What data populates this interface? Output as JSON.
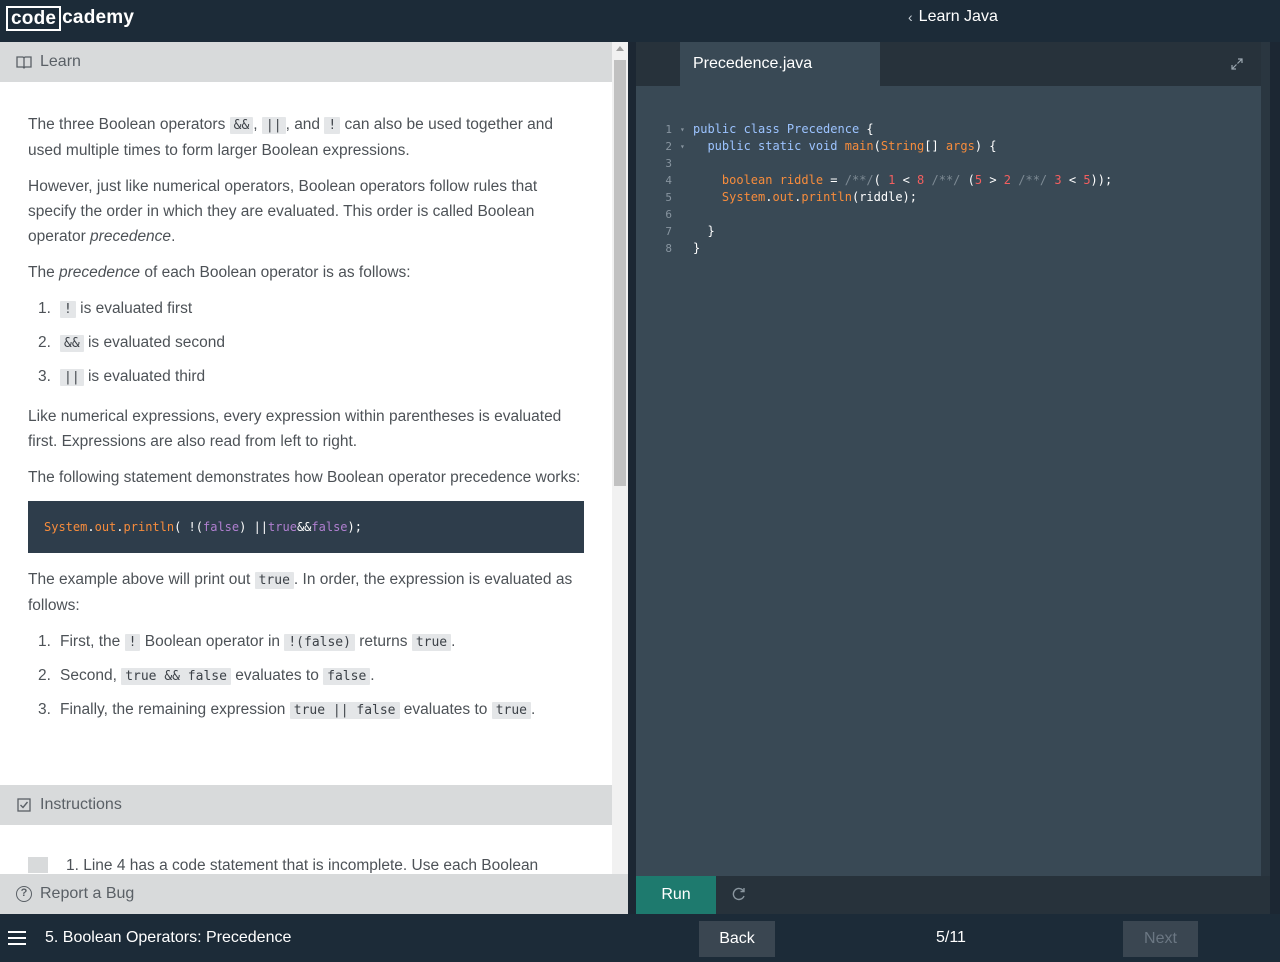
{
  "header": {
    "logo_code": "code",
    "logo_academy": "cademy",
    "course_link": "Learn Java"
  },
  "learn": {
    "heading": "Learn",
    "p1": {
      "a": "The three Boolean operators ",
      "op1": "&&",
      "b": ", ",
      "op2": "||",
      "c": ", and ",
      "op3": "!",
      "d": " can also be used together and used multiple times to form larger Boolean expressions."
    },
    "p2": {
      "a": "However, just like numerical operators, Boolean operators follow rules that specify the order in which they are evaluated. This order is called Boolean operator ",
      "em": "precedence",
      "b": "."
    },
    "p3": {
      "a": "The ",
      "em": "precedence",
      "b": " of each Boolean operator is as follows:"
    },
    "list1": [
      {
        "num": "1.",
        "code": "!",
        "text": " is evaluated first"
      },
      {
        "num": "2.",
        "code": "&&",
        "text": " is evaluated second"
      },
      {
        "num": "3.",
        "code": "||",
        "text": " is evaluated third"
      }
    ],
    "p4": "Like numerical expressions, every expression within parentheses is evaluated first. Expressions are also read from left to right.",
    "p5": "The following statement demonstrates how Boolean operator precedence works:",
    "codeblock": {
      "t1": "System",
      "t2": ".",
      "t3": "out",
      "t4": ".",
      "t5": "println",
      "t6": "( !(",
      "t7": "false",
      "t8": ") || ",
      "t9": "true",
      "t10": " && ",
      "t11": "false",
      "t12": ");"
    },
    "p6": {
      "a": "The example above will print out ",
      "code": "true",
      "b": ". In order, the expression is evaluated as follows:"
    },
    "list2": [
      {
        "num": "1.",
        "a": "First, the ",
        "c1": "!",
        "b": " Boolean operator in ",
        "c2": "!(false)",
        "c": " returns ",
        "c3": "true",
        "d": "."
      },
      {
        "num": "2.",
        "a": "Second, ",
        "c1": "true && false",
        "b": " evaluates to ",
        "c2": "false",
        "c": "."
      },
      {
        "num": "3.",
        "a": "Finally, the remaining expression ",
        "c1": "true || false",
        "b": " evaluates to ",
        "c2": "true",
        "c": "."
      }
    ]
  },
  "instructions": {
    "heading": "Instructions",
    "item_text": "1. Line 4 has a code statement that is incomplete. Use each Boolean"
  },
  "report_bug": "Report a Bug",
  "editor": {
    "file_tab": "Precedence.java",
    "lines": [
      {
        "n": "1",
        "fold": "▾"
      },
      {
        "n": "2",
        "fold": "▾"
      },
      {
        "n": "3",
        "fold": ""
      },
      {
        "n": "4",
        "fold": ""
      },
      {
        "n": "5",
        "fold": ""
      },
      {
        "n": "6",
        "fold": ""
      },
      {
        "n": "7",
        "fold": ""
      },
      {
        "n": "8",
        "fold": ""
      }
    ],
    "code": {
      "l1": {
        "a": "public class ",
        "b": "Precedence",
        "c": " {"
      },
      "l2": {
        "a": "  public static void ",
        "b": "main",
        "c": "(",
        "d": "String",
        "e": "[] ",
        "f": "args",
        "g": ") {"
      },
      "l4": {
        "a": "    boolean ",
        "b": "riddle",
        "c": " = ",
        "d": "/**/",
        "e": "( ",
        "f": "1",
        "g": " < ",
        "h": "8",
        "i": " ",
        "j": "/**/",
        "k": " (",
        "l": "5",
        "m": " > ",
        "n": "2",
        "o": " ",
        "p": "/**/",
        "q": " ",
        "r": "3",
        "s": " < ",
        "t": "5",
        "u": "));"
      },
      "l5": {
        "a": "    System",
        "b": ".",
        "c": "out",
        "d": ".",
        "e": "println",
        "f": "(riddle);"
      },
      "l7": "  }",
      "l8": "}"
    },
    "run_label": "Run"
  },
  "footer": {
    "lesson_title": "5. Boolean Operators: Precedence",
    "back_label": "Back",
    "progress": "5/11",
    "next_label": "Next"
  },
  "colors": {
    "accent": "#1e7a6e",
    "topbar": "#1c2b38",
    "editor_bg": "#394955",
    "keyword": "#9cc3ff",
    "identifier": "#f78c3c"
  },
  "icons": [
    "book-icon",
    "checkbox-icon",
    "question-circle-icon",
    "expand-icon",
    "reset-icon",
    "menu-icon",
    "chevron-left-icon",
    "fold-arrow-icon"
  ]
}
